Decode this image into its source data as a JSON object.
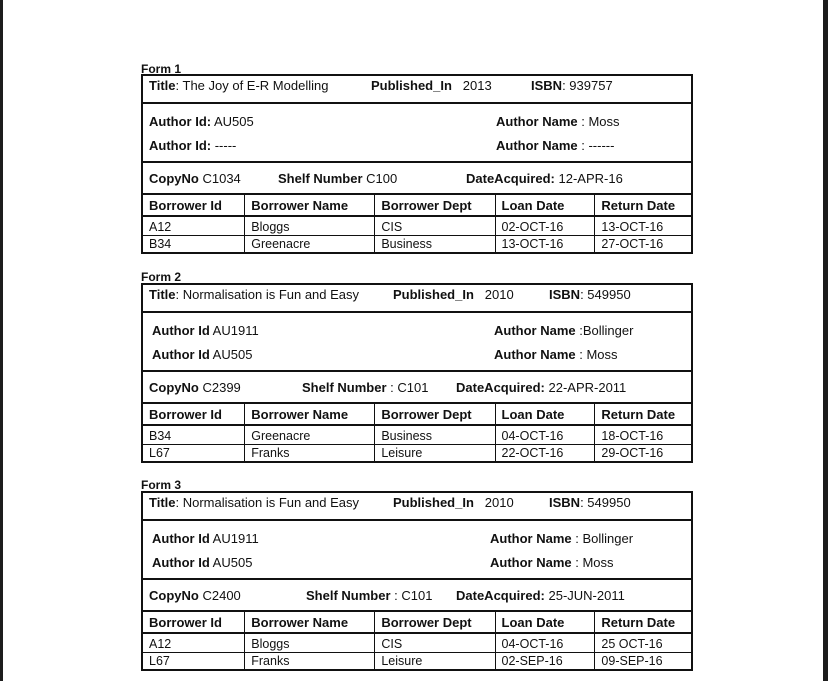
{
  "forms": [
    {
      "label": "Form 1",
      "title_label": "Title",
      "title": "The Joy of E-R Modelling",
      "published_label": "Published_In",
      "published": "2013",
      "isbn_label": "ISBN",
      "isbn": "939757",
      "authors": [
        {
          "id_label": "Author Id:",
          "id": "AU505",
          "name_label": "Author Name",
          "name": ": Moss"
        },
        {
          "id_label": "Author Id:",
          "id": "-----",
          "name_label": "Author Name",
          "name": ": ------"
        }
      ],
      "copy_label": "CopyNo",
      "copy": "C1034",
      "shelf_label": "Shelf Number",
      "shelf": "C100",
      "acquired_label": "DateAcquired:",
      "acquired": "12-APR-16",
      "columns": [
        "Borrower Id",
        "Borrower Name",
        "Borrower Dept",
        "Loan Date",
        "Return Date"
      ],
      "rows": [
        [
          "A12",
          "Bloggs",
          "CIS",
          "02-OCT-16",
          "13-OCT-16"
        ],
        [
          "B34",
          "Greenacre",
          "Business",
          "13-OCT-16",
          "27-OCT-16"
        ]
      ]
    },
    {
      "label": "Form 2",
      "title_label": "Title",
      "title": "Normalisation is Fun and Easy",
      "published_label": "Published_In",
      "published": "2010",
      "isbn_label": "ISBN",
      "isbn": "549950",
      "authors": [
        {
          "id_label": "Author Id",
          "id": "AU1911",
          "name_label": "Author Name",
          "name": ":Bollinger"
        },
        {
          "id_label": "Author Id",
          "id": "AU505",
          "name_label": "Author Name",
          "name": ": Moss"
        }
      ],
      "copy_label": "CopyNo",
      "copy": "C2399",
      "shelf_label": "Shelf Number",
      "shelf": ":  C101",
      "acquired_label": "DateAcquired:",
      "acquired": "22-APR-2011",
      "columns": [
        "Borrower Id",
        "Borrower Name",
        "Borrower Dept",
        "Loan Date",
        "Return Date"
      ],
      "rows": [
        [
          "B34",
          "Greenacre",
          "Business",
          "04-OCT-16",
          "18-OCT-16"
        ],
        [
          "L67",
          "Franks",
          "Leisure",
          "22-OCT-16",
          "29-OCT-16"
        ]
      ]
    },
    {
      "label": "Form 3",
      "title_label": "Title",
      "title": "Normalisation is Fun and Easy",
      "published_label": "Published_In",
      "published": "2010",
      "isbn_label": "ISBN",
      "isbn": "549950",
      "authors": [
        {
          "id_label": "Author Id",
          "id": "AU1911",
          "name_label": "Author Name",
          "name": ": Bollinger"
        },
        {
          "id_label": "Author Id",
          "id": "AU505",
          "name_label": "Author Name",
          "name": ": Moss"
        }
      ],
      "copy_label": "CopyNo",
      "copy": "C2400",
      "shelf_label": "Shelf Number",
      "shelf": ":  C101",
      "acquired_label": "DateAcquired:",
      "acquired": "25-JUN-2011",
      "columns": [
        "Borrower Id",
        "Borrower Name",
        "Borrower Dept",
        "Loan Date",
        "Return Date"
      ],
      "rows": [
        [
          "A12",
          "Bloggs",
          "CIS",
          "04-OCT-16",
          "25 OCT-16"
        ],
        [
          "L67",
          "Franks",
          "Leisure",
          "02-SEP-16",
          "09-SEP-16"
        ]
      ]
    }
  ]
}
